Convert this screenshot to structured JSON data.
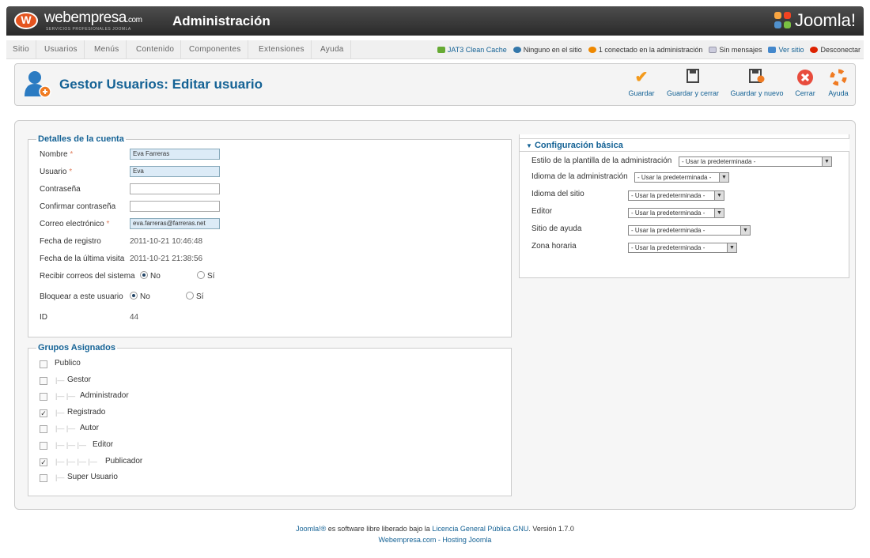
{
  "header": {
    "brand": "webempresa",
    "brand_suffix": ".com",
    "brand_sub": "SERVICIOS PROFESIONALES JOOMLA",
    "title": "Administración",
    "joomla": "Joomla!"
  },
  "menu": [
    "Sitio",
    "Usuarios",
    "Menús",
    "Contenido",
    "Componentes",
    "Extensiones",
    "Ayuda"
  ],
  "status": {
    "cache": "JAT3 Clean Cache",
    "site": "Ninguno en el sitio",
    "admin": "1 conectado en la administración",
    "messages": "Sin mensajes",
    "view_site": "Ver sitio",
    "logout": "Desconectar"
  },
  "toolbar": {
    "title": "Gestor Usuarios: Editar usuario",
    "save": "Guardar",
    "save_close": "Guardar y cerrar",
    "save_new": "Guardar y nuevo",
    "close": "Cerrar",
    "help": "Ayuda"
  },
  "account": {
    "legend": "Detalles de la cuenta",
    "name_label": "Nombre",
    "name_value": "Eva Farreras",
    "user_label": "Usuario",
    "user_value": "Eva",
    "password_label": "Contraseña",
    "confirm_label": "Confirmar contraseña",
    "email_label": "Correo electrónico",
    "email_value": "eva.farreras@farreras.net",
    "registered_label": "Fecha de registro",
    "registered_value": "2011-10-21 10:46:48",
    "lastvisit_label": "Fecha de la última visita",
    "lastvisit_value": "2011-10-21 21:38:56",
    "sendmail_label": "Recibir correos del sistema",
    "block_label": "Bloquear a este usuario",
    "no": "No",
    "yes": "Sí",
    "id_label": "ID",
    "id_value": "44"
  },
  "groups": {
    "legend": "Grupos Asignados",
    "items": [
      {
        "label": "Publico",
        "depth": 0,
        "checked": false
      },
      {
        "label": "Gestor",
        "depth": 1,
        "checked": false
      },
      {
        "label": "Administrador",
        "depth": 2,
        "checked": false
      },
      {
        "label": "Registrado",
        "depth": 1,
        "checked": true
      },
      {
        "label": "Autor",
        "depth": 2,
        "checked": false
      },
      {
        "label": "Editor",
        "depth": 3,
        "checked": false
      },
      {
        "label": "Publicador",
        "depth": 4,
        "checked": true
      },
      {
        "label": "Super Usuario",
        "depth": 1,
        "checked": false
      }
    ]
  },
  "basic": {
    "legend": "Configuración básica",
    "admin_style_label": "Estilo de la plantilla de la administración",
    "admin_lang_label": "Idioma de la administración",
    "site_lang_label": "Idioma del sitio",
    "editor_label": "Editor",
    "help_site_label": "Sitio de ayuda",
    "timezone_label": "Zona horaria",
    "default": "- Usar la predeterminada -"
  },
  "footer": {
    "joomla": "Joomla!®",
    "text": " es software libre liberado bajo la ",
    "license": "Licencia General Pública GNU",
    "version": ".   Versión 1.7.0",
    "line2": "Webempresa.com - Hosting Joomla"
  }
}
